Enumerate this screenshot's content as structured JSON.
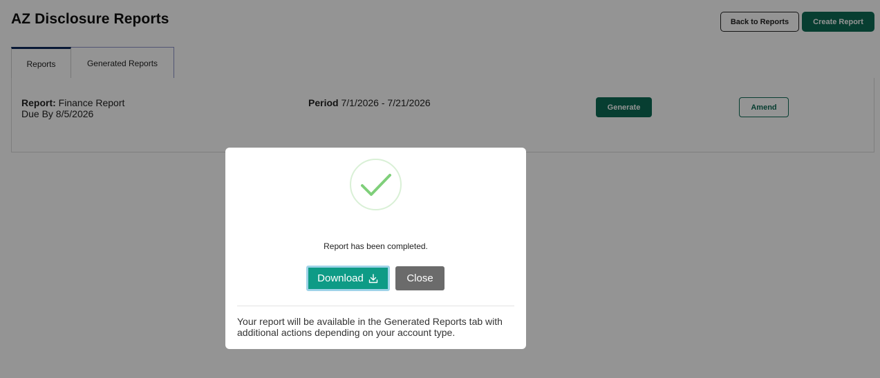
{
  "header": {
    "title": "AZ Disclosure Reports",
    "back_button": "Back to Reports",
    "create_button": "Create Report"
  },
  "tabs": [
    {
      "label": "Reports",
      "active": true
    },
    {
      "label": "Generated Reports",
      "active": false
    }
  ],
  "report": {
    "name_label": "Report:",
    "name_value": "Finance Report",
    "due": "Due By 8/5/2026",
    "period_label": "Period",
    "period_value": "7/1/2026 - 7/21/2026",
    "generate_button": "Generate",
    "amend_button": "Amend"
  },
  "modal": {
    "icon": "check-icon",
    "message": "Report has been completed.",
    "download_button": "Download",
    "download_icon": "download-icon",
    "close_button": "Close",
    "footer": "Your report will be available in the Generated Reports tab with additional actions depending on your account type."
  },
  "colors": {
    "primary": "#0d6b55",
    "download": "#0e9b86",
    "close": "#6b6b6b",
    "check": "#7fcf7a",
    "overlay": "rgba(0,0,0,0.42)"
  }
}
